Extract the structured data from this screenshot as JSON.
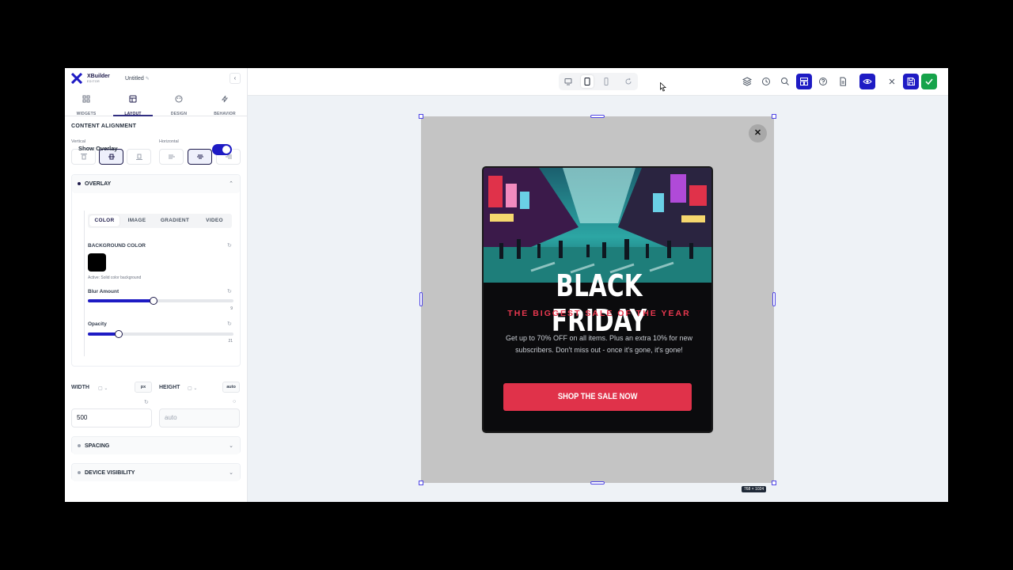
{
  "app": {
    "brand": "XBuilder",
    "brand_sub": "EDITOR",
    "doc_title": "Untitled"
  },
  "sidebar": {
    "tabs": [
      {
        "label": "WIDGETS",
        "icon": "grid-icon"
      },
      {
        "label": "LAYOUT",
        "icon": "layout-icon",
        "active": true
      },
      {
        "label": "DESIGN",
        "icon": "palette-icon"
      },
      {
        "label": "BEHAVIOR",
        "icon": "bolt-icon"
      }
    ],
    "content_alignment": {
      "title": "CONTENT ALIGNMENT",
      "vertical_label": "Vertical",
      "horizontal_label": "Horizontal",
      "vertical_selected": "middle",
      "horizontal_selected": "center"
    },
    "overlay": {
      "title": "OVERLAY",
      "show_label": "Show Overlay",
      "show_enabled": true,
      "tabs": [
        "COLOR",
        "IMAGE",
        "GRADIENT",
        "VIDEO"
      ],
      "active_tab": "COLOR",
      "bg_label": "BACKGROUND COLOR",
      "bg_color": "#000000",
      "bg_note": "Active: Solid color background",
      "blur": {
        "label": "Blur Amount",
        "value": "9",
        "fraction": 0.45
      },
      "opacity": {
        "label": "Opacity",
        "value": "21",
        "fraction": 0.21
      }
    },
    "size": {
      "width_label": "WIDTH",
      "width_unit": "px",
      "width_value": "500",
      "height_label": "HEIGHT",
      "height_unit": "auto",
      "height_placeholder": "auto"
    },
    "spacing": {
      "title": "SPACING"
    },
    "device_visibility": {
      "title": "DEVICE VISIBILITY"
    }
  },
  "topbar": {
    "devices": [
      "desktop",
      "tablet",
      "mobile"
    ],
    "active_device": "tablet"
  },
  "canvas": {
    "size_badge": "768 × 1024",
    "popup": {
      "title": "BLACK FRIDAY",
      "subtitle": "THE BIGGEST SALE OF THE YEAR",
      "body": "Get up to 70% OFF on all items. Plus an extra 10% for new subscribers. Don't miss out - once it's gone, it's gone!",
      "cta": "SHOP THE SALE NOW",
      "cta_color": "#e0324a",
      "subtitle_color": "#e8384f"
    }
  }
}
